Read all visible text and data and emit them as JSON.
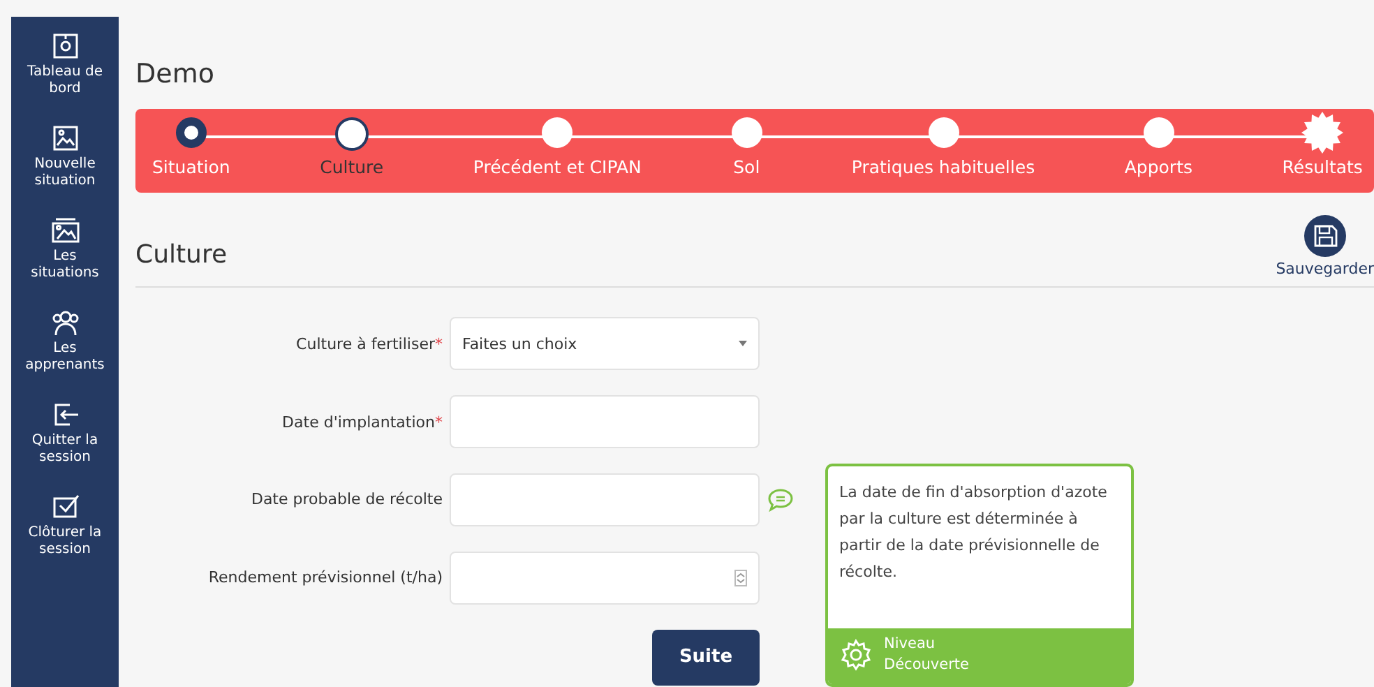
{
  "sidebar": {
    "items": [
      {
        "kind": "dashboard",
        "label": "Tableau de bord"
      },
      {
        "kind": "image",
        "label": "Nouvelle situation"
      },
      {
        "kind": "gallery",
        "label": "Les situations"
      },
      {
        "kind": "people",
        "label": "Les apprenants"
      },
      {
        "kind": "exit",
        "label": "Quitter la session"
      },
      {
        "kind": "check",
        "label": "Clôturer la session"
      }
    ]
  },
  "page_title": "Demo",
  "stepper": {
    "steps": [
      {
        "label": "Situation",
        "done": true,
        "selected": false,
        "kind": "circle"
      },
      {
        "label": "Culture",
        "done": false,
        "selected": true,
        "kind": "circle"
      },
      {
        "label": "Précédent et CIPAN",
        "done": false,
        "selected": false,
        "kind": "circle"
      },
      {
        "label": "Sol",
        "done": false,
        "selected": false,
        "kind": "circle"
      },
      {
        "label": "Pratiques habituelles",
        "done": false,
        "selected": false,
        "kind": "circle"
      },
      {
        "label": "Apports",
        "done": false,
        "selected": false,
        "kind": "circle"
      },
      {
        "label": "Résultats",
        "done": false,
        "selected": false,
        "kind": "star"
      }
    ]
  },
  "section": {
    "title": "Culture",
    "save_label": "Sauvegarder"
  },
  "form": {
    "fields": [
      {
        "label": "Culture à fertiliser",
        "required_mark": "*",
        "kind": "select",
        "value": "Faites un choix",
        "help": false
      },
      {
        "label": "Date d'implantation",
        "required_mark": "*",
        "kind": "text",
        "help": false
      },
      {
        "label": "Date probable de récolte",
        "kind": "text",
        "help": true
      },
      {
        "label": "Rendement prévisionnel (t/ha)",
        "kind": "number",
        "help": false
      }
    ],
    "submit": "Suite"
  },
  "tip": {
    "text": "La date de fin d'absorption d'azote par la culture est déterminée à partir de la date prévisionnelle de récolte.",
    "level_label": "Niveau",
    "level_name": "Découverte"
  }
}
